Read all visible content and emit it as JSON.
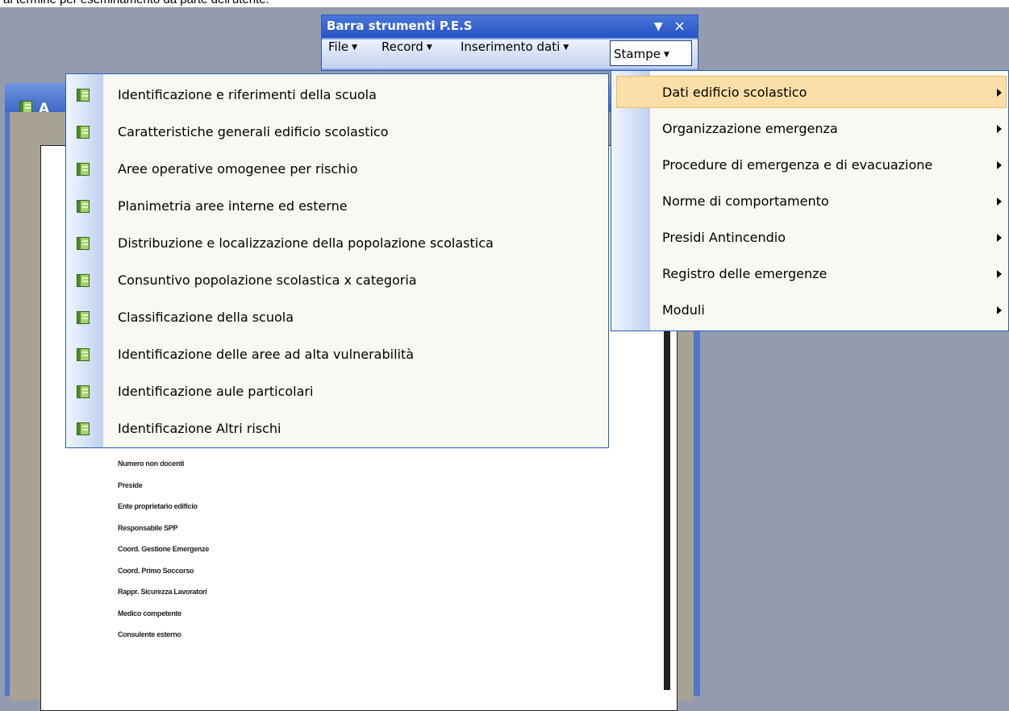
{
  "top_strip": {
    "text": "al termine per eseminamento da parte dell'utente."
  },
  "document_window": {
    "title": "A"
  },
  "report_labels": [
    "Numero non docenti",
    "Preside",
    "Ente proprietario edificio",
    "Responsabile SPP",
    "Coord. Gestione Emergenze",
    "Coord. Primo Soccorso",
    "Rappr. Sicurezza Lavoratori",
    "Medico competente",
    "Consulente esterno"
  ],
  "toolbar": {
    "title": "Barra strumenti P.E.S",
    "dropdown_icon": "▼",
    "close_icon": "×",
    "menus": [
      {
        "label": "File",
        "caret": "▼"
      },
      {
        "label": "Record",
        "caret": "▼"
      },
      {
        "label": "Inserimento dati",
        "caret": "▼"
      },
      {
        "label": "Stampe",
        "caret": "▼"
      }
    ]
  },
  "inserimento_menu": {
    "items": [
      {
        "label": " Identificazione e riferimenti della scuola",
        "icon": "form-icon"
      },
      {
        "label": "Caratteristiche generali edificio scolastico",
        "icon": "form-icon"
      },
      {
        "label": "Aree operative omogenee per rischio",
        "icon": "form-icon"
      },
      {
        "label": " Planimetria aree interne ed esterne",
        "icon": "form-icon"
      },
      {
        "label": "Distribuzione e localizzazione della popolazione scolastica",
        "icon": "form-icon"
      },
      {
        "label": "Consuntivo popolazione scolastica x categoria",
        "icon": "form-icon"
      },
      {
        "label": "Classificazione della scuola",
        "icon": "form-icon"
      },
      {
        "label": "Identificazione delle aree ad alta vulnerabilità",
        "icon": "form-icon"
      },
      {
        "label": "Identificazione aule particolari",
        "icon": "form-icon"
      },
      {
        "label": "Identificazione Altri rischi",
        "icon": "form-icon"
      }
    ]
  },
  "stampe_menu": {
    "items": [
      {
        "label": "Dati edificio scolastico",
        "selected": true
      },
      {
        "label": "Organizzazione emergenza",
        "selected": false
      },
      {
        "label": "Procedure di emergenza e di evacuazione",
        "selected": false
      },
      {
        "label": "Norme di comportamento",
        "selected": false
      },
      {
        "label": "Presidi Antincendio",
        "selected": false
      },
      {
        "label": "Registro delle emergenze",
        "selected": false
      },
      {
        "label": "Moduli",
        "selected": false
      }
    ]
  },
  "colors": {
    "desktop": "#939caf",
    "title_bar": "#2653c5",
    "selected_highlight": "#fcdfa8",
    "menu_background": "#f9f8f2"
  }
}
